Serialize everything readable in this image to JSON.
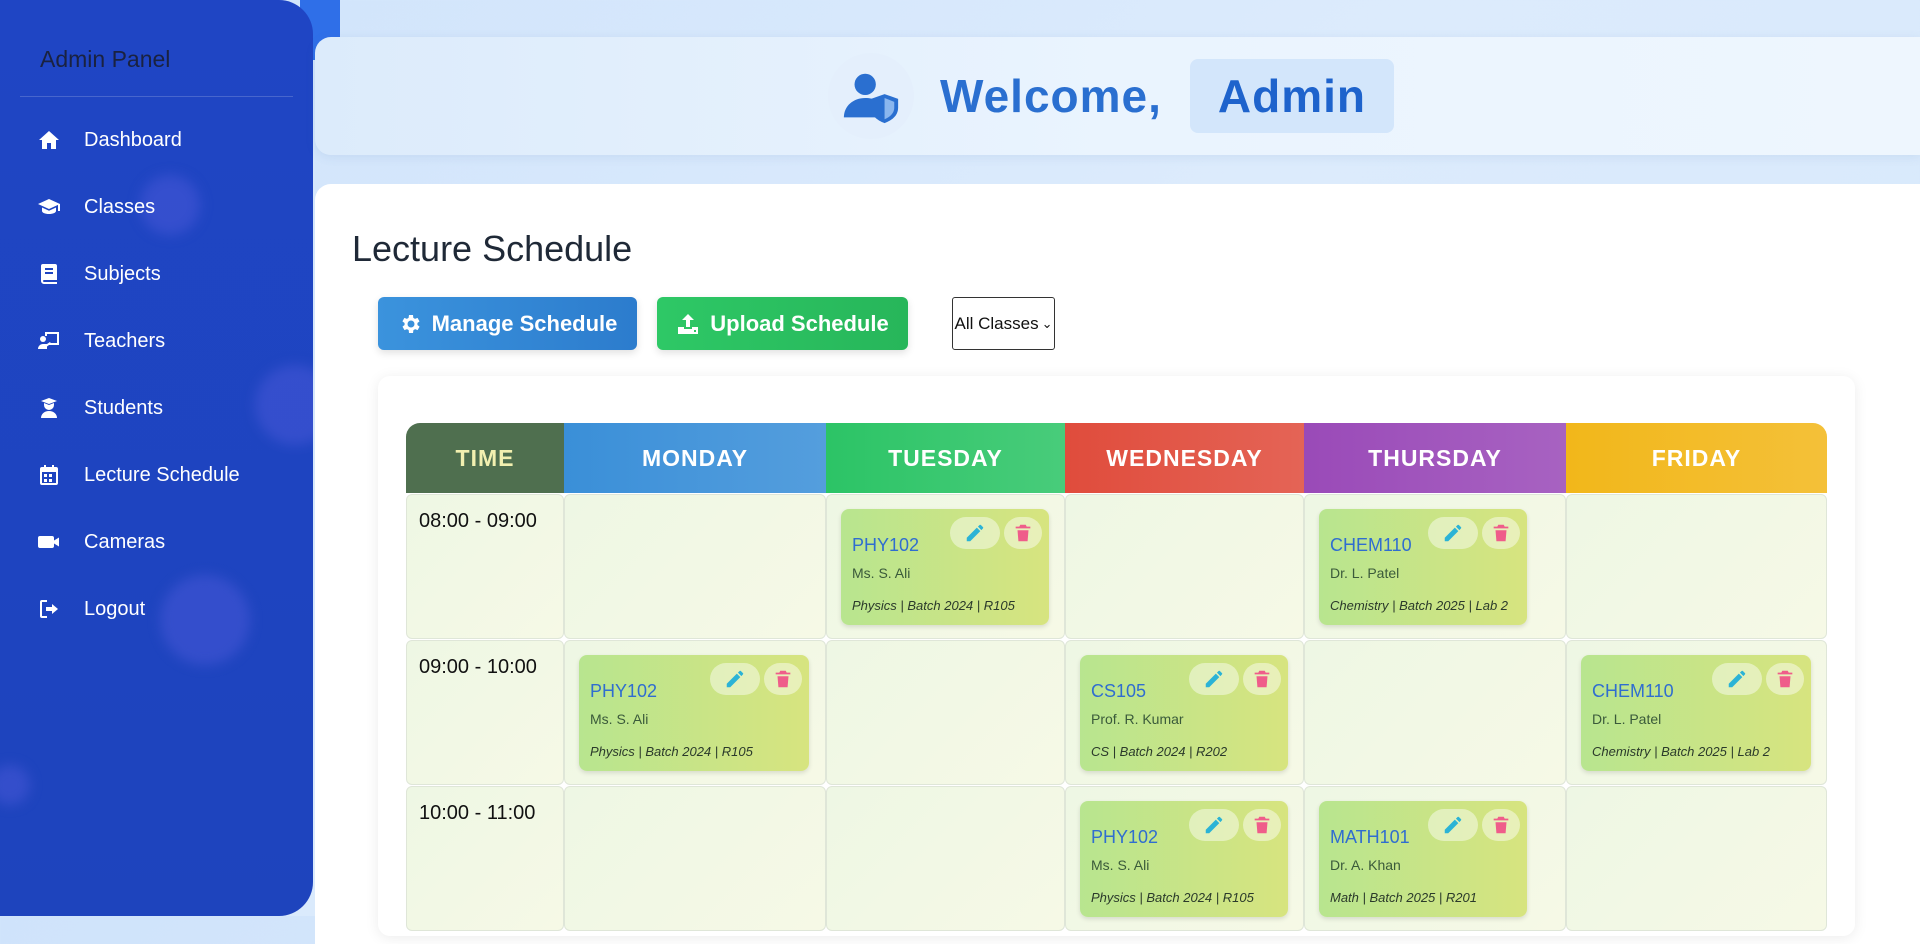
{
  "sidebar": {
    "title": "Admin Panel",
    "items": [
      {
        "label": "Dashboard",
        "icon": "home-icon"
      },
      {
        "label": "Classes",
        "icon": "graduation-cap-icon"
      },
      {
        "label": "Subjects",
        "icon": "book-icon"
      },
      {
        "label": "Teachers",
        "icon": "chalkboard-teacher-icon"
      },
      {
        "label": "Students",
        "icon": "user-graduate-icon"
      },
      {
        "label": "Lecture Schedule",
        "icon": "calendar-icon"
      },
      {
        "label": "Cameras",
        "icon": "video-camera-icon"
      },
      {
        "label": "Logout",
        "icon": "logout-icon"
      }
    ]
  },
  "header": {
    "welcome": "Welcome,",
    "user": "Admin",
    "avatar_icon": "user-shield-icon"
  },
  "main": {
    "title": "Lecture Schedule",
    "manage_button": "Manage Schedule",
    "upload_button": "Upload Schedule",
    "class_filter": "All Classes"
  },
  "schedule": {
    "time_header": "TIME",
    "days": [
      {
        "label": "MONDAY",
        "color": "#3a8fd8"
      },
      {
        "label": "TUESDAY",
        "color": "#2cc466"
      },
      {
        "label": "WEDNESDAY",
        "color": "#e04c3c"
      },
      {
        "label": "THURSDAY",
        "color": "#9a4ab8"
      },
      {
        "label": "FRIDAY",
        "color": "#f2b71a"
      }
    ],
    "time_header_color": "#4f6f4f",
    "slots": [
      "08:00 - 09:00",
      "09:00 - 10:00",
      "10:00 - 11:00"
    ],
    "lectures": [
      {
        "slot": 0,
        "day": 1,
        "code": "PHY102",
        "teacher": "Ms. S. Ali",
        "meta": "Physics | Batch 2024 | R105"
      },
      {
        "slot": 0,
        "day": 3,
        "code": "CHEM110",
        "teacher": "Dr. L. Patel",
        "meta": "Chemistry | Batch 2025 | Lab 2"
      },
      {
        "slot": 1,
        "day": 0,
        "code": "PHY102",
        "teacher": "Ms. S. Ali",
        "meta": "Physics | Batch 2024 | R105"
      },
      {
        "slot": 1,
        "day": 2,
        "code": "CS105",
        "teacher": "Prof. R. Kumar",
        "meta": "CS | Batch 2024 | R202"
      },
      {
        "slot": 1,
        "day": 4,
        "code": "CHEM110",
        "teacher": "Dr. L. Patel",
        "meta": "Chemistry | Batch 2025 | Lab 2"
      },
      {
        "slot": 2,
        "day": 2,
        "code": "PHY102",
        "teacher": "Ms. S. Ali",
        "meta": "Physics | Batch 2024 | R105"
      },
      {
        "slot": 2,
        "day": 3,
        "code": "MATH101",
        "teacher": "Dr. A. Khan",
        "meta": "Math | Batch 2025 | R201"
      }
    ]
  }
}
